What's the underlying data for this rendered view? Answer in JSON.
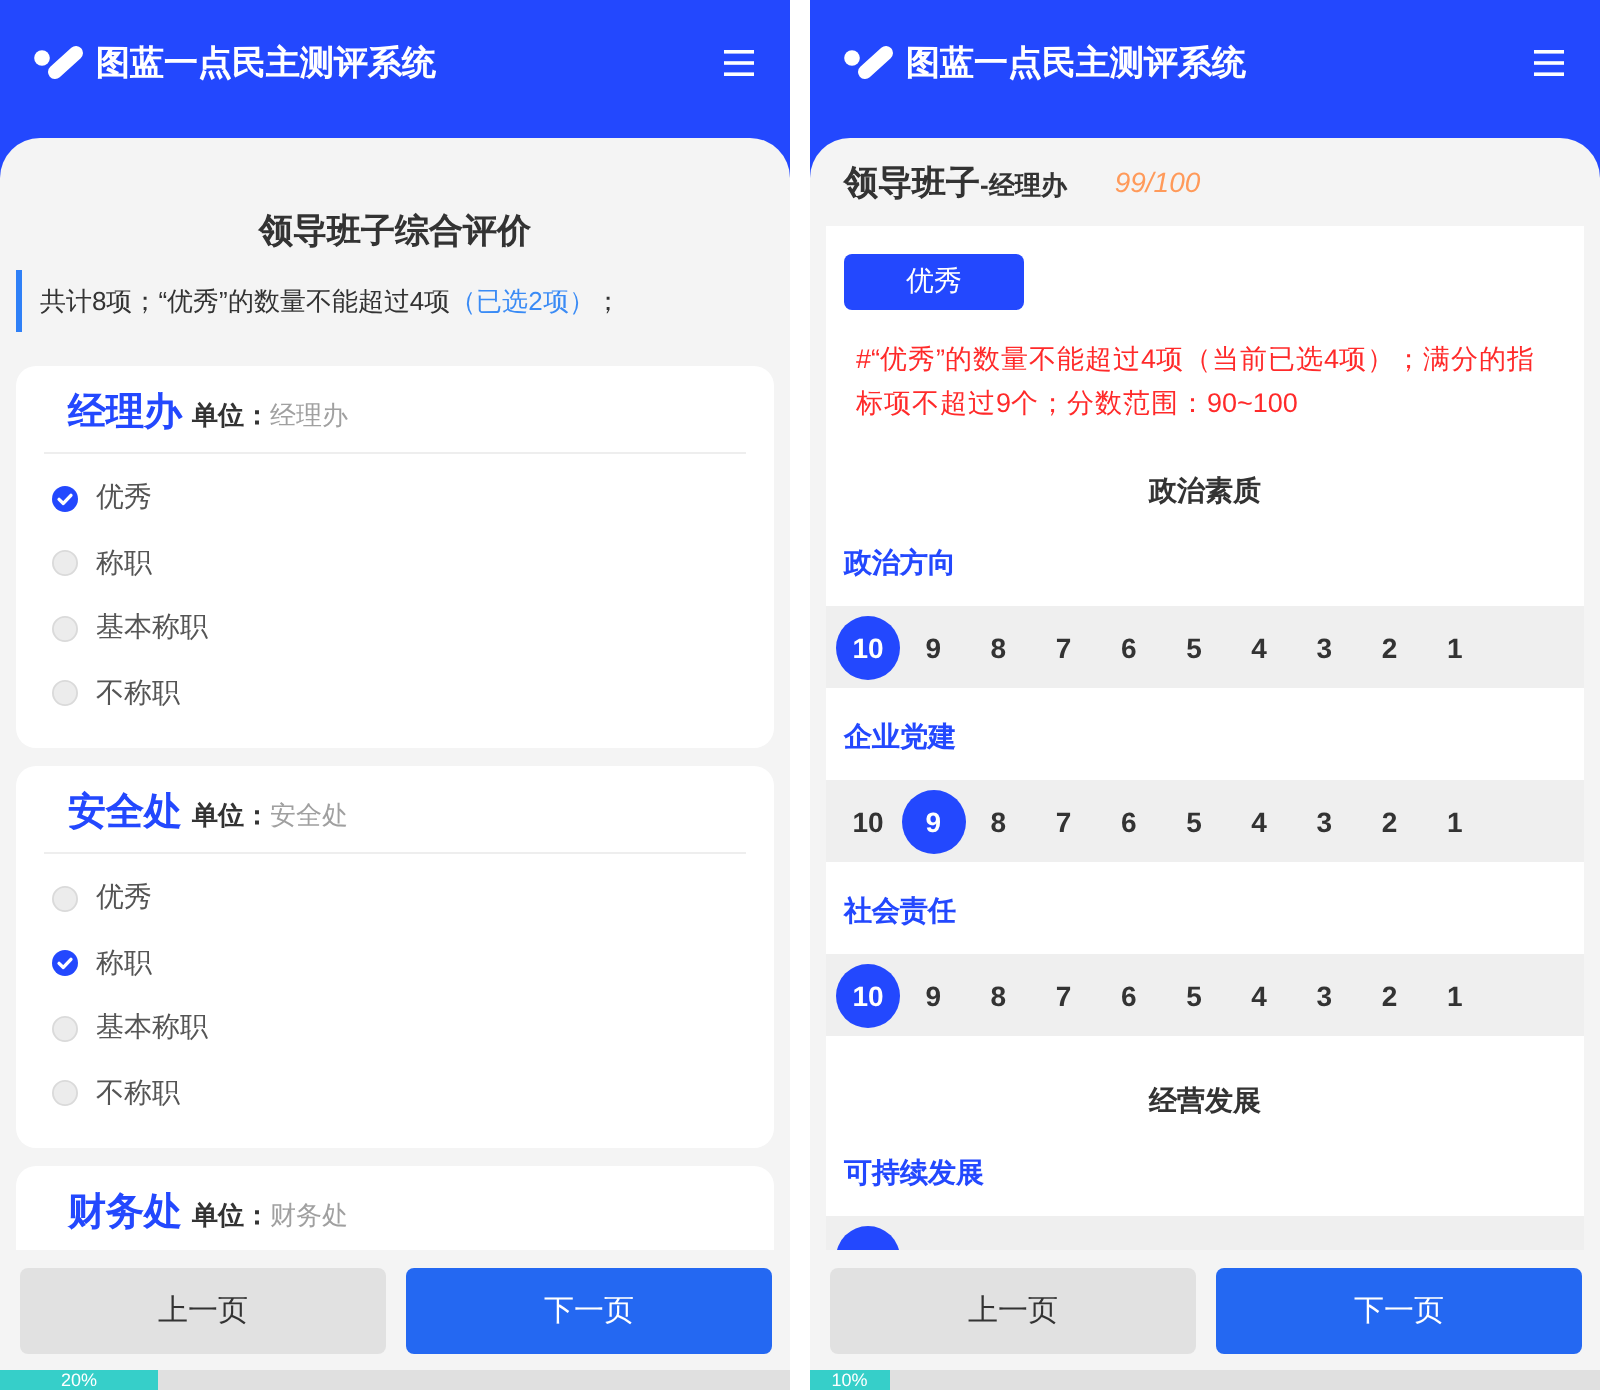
{
  "screens": [
    {
      "kind": "unit_list",
      "header": {
        "title": "图蓝一点民主测评系统"
      },
      "page_title": "领导班子综合评价",
      "notice": {
        "text": "共计8项；“优秀”的数量不能超过4项",
        "highlight": "（已选2项）",
        "tail": "；"
      },
      "units": [
        {
          "name": "经理办",
          "unit_label": "单位：",
          "unit": "经理办",
          "options": [
            {
              "label": "优秀",
              "selected": true
            },
            {
              "label": "称职",
              "selected": false
            },
            {
              "label": "基本称职",
              "selected": false
            },
            {
              "label": "不称职",
              "selected": false
            }
          ]
        },
        {
          "name": "安全处",
          "unit_label": "单位：",
          "unit": "安全处",
          "options": [
            {
              "label": "优秀",
              "selected": false
            },
            {
              "label": "称职",
              "selected": true
            },
            {
              "label": "基本称职",
              "selected": false
            },
            {
              "label": "不称职",
              "selected": false
            }
          ]
        },
        {
          "name": "财务处",
          "unit_label": "单位：",
          "unit": "财务处"
        }
      ],
      "buttons": [
        {
          "label": "上一页",
          "kind": "secondary"
        },
        {
          "label": "下一页",
          "kind": "primary"
        }
      ],
      "progress": {
        "level": 0.2,
        "label": "20%"
      }
    },
    {
      "kind": "scoring",
      "header": {
        "title": "图蓝一点民主测评系统"
      },
      "panel": {
        "title": "领导班子",
        "subtitle": "-经理办",
        "score": "99/100"
      },
      "grade_button": "优秀",
      "warning": "#“优秀”的数量不能超过4项（当前已选4项）；满分的指标项不超过9个；分数范围：90~100",
      "sections": [
        {
          "title": "政治素质",
          "criteria": [
            {
              "label": "政治方向",
              "scores": [
                {
                  "label": "10",
                  "selected": true
                },
                {
                  "label": "9",
                  "selected": false
                },
                {
                  "label": "8",
                  "selected": false
                },
                {
                  "label": "7",
                  "selected": false
                },
                {
                  "label": "6",
                  "selected": false
                },
                {
                  "label": "5",
                  "selected": false
                },
                {
                  "label": "4",
                  "selected": false
                },
                {
                  "label": "3",
                  "selected": false
                },
                {
                  "label": "2",
                  "selected": false
                },
                {
                  "label": "1",
                  "selected": false
                }
              ]
            },
            {
              "label": "企业党建",
              "scores": [
                {
                  "label": "10",
                  "selected": false
                },
                {
                  "label": "9",
                  "selected": true
                },
                {
                  "label": "8",
                  "selected": false
                },
                {
                  "label": "7",
                  "selected": false
                },
                {
                  "label": "6",
                  "selected": false
                },
                {
                  "label": "5",
                  "selected": false
                },
                {
                  "label": "4",
                  "selected": false
                },
                {
                  "label": "3",
                  "selected": false
                },
                {
                  "label": "2",
                  "selected": false
                },
                {
                  "label": "1",
                  "selected": false
                }
              ]
            },
            {
              "label": "社会责任",
              "scores": [
                {
                  "label": "10",
                  "selected": true
                },
                {
                  "label": "9",
                  "selected": false
                },
                {
                  "label": "8",
                  "selected": false
                },
                {
                  "label": "7",
                  "selected": false
                },
                {
                  "label": "6",
                  "selected": false
                },
                {
                  "label": "5",
                  "selected": false
                },
                {
                  "label": "4",
                  "selected": false
                },
                {
                  "label": "3",
                  "selected": false
                },
                {
                  "label": "2",
                  "selected": false
                },
                {
                  "label": "1",
                  "selected": false
                }
              ]
            }
          ]
        },
        {
          "title": "经营发展",
          "criteria": [
            {
              "label": "可持续发展",
              "scores": [
                {
                  "selected": true
                }
              ]
            }
          ]
        }
      ],
      "buttons": [
        {
          "label": "上一页",
          "kind": "secondary"
        },
        {
          "label": "下一页",
          "kind": "primary"
        }
      ],
      "progress": {
        "level": 0.1,
        "label": "10%"
      }
    }
  ]
}
